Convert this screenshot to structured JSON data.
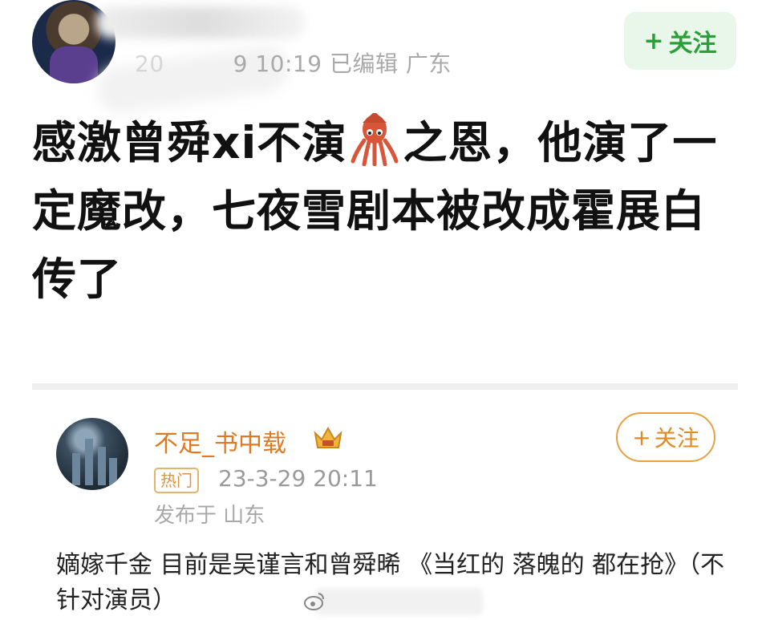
{
  "post": {
    "meta_date_prefix": "20",
    "meta_date_rest": "9 10:19",
    "meta_edited": "已编辑",
    "meta_location": "广东",
    "follow_label": "关注",
    "headline_part1": "感激曾舜xi不演",
    "headline_part2": "之恩，他演了一定魔改，七夜雪剧本被改成霍展白传了"
  },
  "comment": {
    "username": "不足_书中载",
    "follow_label": "关注",
    "hot_badge": "热门",
    "timestamp": "23-3-29 20:11",
    "location": "发布于 山东",
    "body": "嫡嫁千金 目前是吴谨言和曾舜晞 《当红的 落魄的 都在抢》（不针对演员）"
  },
  "colors": {
    "follow_green": "#2aa03a",
    "follow_green_bg": "#e9f6ea",
    "comment_orange": "#e07a22"
  },
  "icons": [
    "plus-icon",
    "squid-emoji-icon",
    "crown-icon",
    "weibo-logo-icon"
  ]
}
